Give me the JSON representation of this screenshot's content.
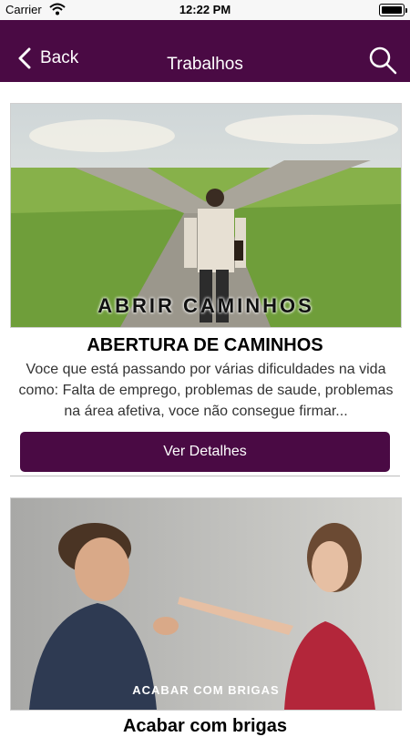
{
  "status_bar": {
    "carrier": "Carrier",
    "time": "12:22 PM"
  },
  "nav": {
    "back_label": "Back",
    "title": "Trabalhos"
  },
  "cards": [
    {
      "image_caption": "ABRIR CAMINHOS",
      "title": "ABERTURA DE CAMINHOS",
      "description": "Voce que está passando por várias dificuldades na vida como: Falta de emprego, problemas de saude, problemas na área afetiva, voce não consegue firmar...",
      "button_label": "Ver Detalhes"
    },
    {
      "image_caption": "ACABAR COM BRIGAS",
      "title": "Acabar com brigas"
    }
  ],
  "colors": {
    "brand": "#4a0a44"
  }
}
